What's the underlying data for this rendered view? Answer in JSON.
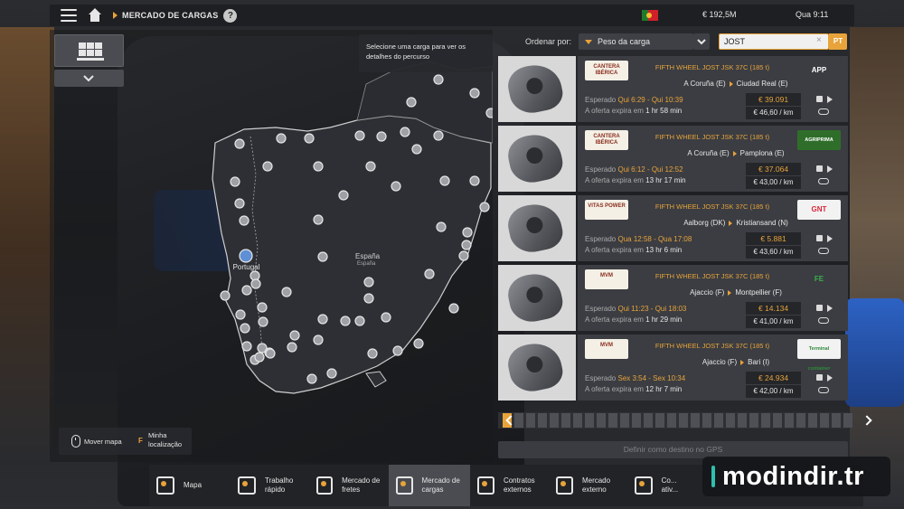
{
  "topbar": {
    "title": "MERCADO DE CARGAS",
    "help": "?",
    "money": "€ 192,5M",
    "time": "Qua 9:11"
  },
  "map": {
    "hint": "Selecione uma carga para ver os detalhes do percurso",
    "city_label": "Portugal",
    "country": "España",
    "country_sub": "España",
    "legend_move": "Mover mapa",
    "legend_key": "F",
    "legend_location": "Minha localização"
  },
  "sort": {
    "label": "Ordenar por:",
    "value": "Peso da carga",
    "search_value": "JOST",
    "clear": "×",
    "lang": "PT"
  },
  "cargos": [
    {
      "name": "FIFTH WHEEL JOST JSK 37C (185 t)",
      "from_company": "CANTERA IBÉRICA",
      "to_company": "APP",
      "to_color": "#ffffff",
      "to_bg": "#3b3d42",
      "from": "A Coruña (E)",
      "to": "Ciudad Real (E)",
      "expected_label": "Esperado",
      "expected": "Qui 6:29 - Qui 10:39",
      "expires_label": "A oferta expira em",
      "expires": "1 hr 58 min",
      "price": "€ 39.091",
      "per_km": "€ 46,60 / km"
    },
    {
      "name": "FIFTH WHEEL JOST JSK 37C (185 t)",
      "from_company": "CANTERA IBÉRICA",
      "to_company": "AGRIPRIMA",
      "to_color": "#ffffff",
      "to_bg": "#2f6e2a",
      "from": "A Coruña (E)",
      "to": "Pamplona (E)",
      "expected_label": "Esperado",
      "expected": "Qui 6:12 - Qui 12:52",
      "expires_label": "A oferta expira em",
      "expires": "13 hr 17 min",
      "price": "€ 37.064",
      "per_km": "€ 43,00 / km"
    },
    {
      "name": "FIFTH WHEEL JOST JSK 37C (185 t)",
      "from_company": "VITAS POWER",
      "to_company": "GNT",
      "to_color": "#d8273a",
      "to_bg": "#f2f2f2",
      "from": "Aalborg (DK)",
      "to": "Kristiansand (N)",
      "expected_label": "Esperado",
      "expected": "Qua 12:58 - Qua 17:08",
      "expires_label": "A oferta expira em",
      "expires": "13 hr 6 min",
      "price": "€ 5.881",
      "per_km": "€ 43,60 / km"
    },
    {
      "name": "FIFTH WHEEL JOST JSK 37C (185 t)",
      "from_company": "MVM",
      "to_company": "FE",
      "to_color": "#3bb04a",
      "to_bg": "#3b3d42",
      "from": "Ajaccio (F)",
      "to": "Montpellier (F)",
      "expected_label": "Esperado",
      "expected": "Qui 11:23 - Qui 18:03",
      "expires_label": "A oferta expira em",
      "expires": "1 hr 29 min",
      "price": "€ 14.134",
      "per_km": "€ 41,00 / km"
    },
    {
      "name": "FIFTH WHEEL JOST JSK 37C (185 t)",
      "from_company": "MVM",
      "to_company": "Terminal container",
      "to_color": "#2f8a3a",
      "to_bg": "#f2f2f2",
      "from": "Ajaccio (F)",
      "to": "Bari (I)",
      "expected_label": "Esperado",
      "expected": "Sex 3:54 - Sex 10:34",
      "expires_label": "A oferta expira em",
      "expires": "12 hr 7 min",
      "price": "€ 24.934",
      "per_km": "€ 42,00 / km"
    }
  ],
  "pager": {
    "pages": 30,
    "current": 1
  },
  "gps_button": "Definir como destino no GPS",
  "bottom_nav": [
    {
      "label": "Mapa",
      "active": false
    },
    {
      "label": "Trabalho rápido",
      "active": false
    },
    {
      "label": "Mercado de fretes",
      "active": false
    },
    {
      "label": "Mercado de cargas",
      "active": true
    },
    {
      "label": "Contratos externos",
      "active": false
    },
    {
      "label": "Mercado externo",
      "active": false
    },
    {
      "label": "Co... ativ...",
      "active": false
    }
  ],
  "watermark": "modindir.tr",
  "colors": {
    "accent": "#e8a33a",
    "panel": "#3b3d42"
  }
}
